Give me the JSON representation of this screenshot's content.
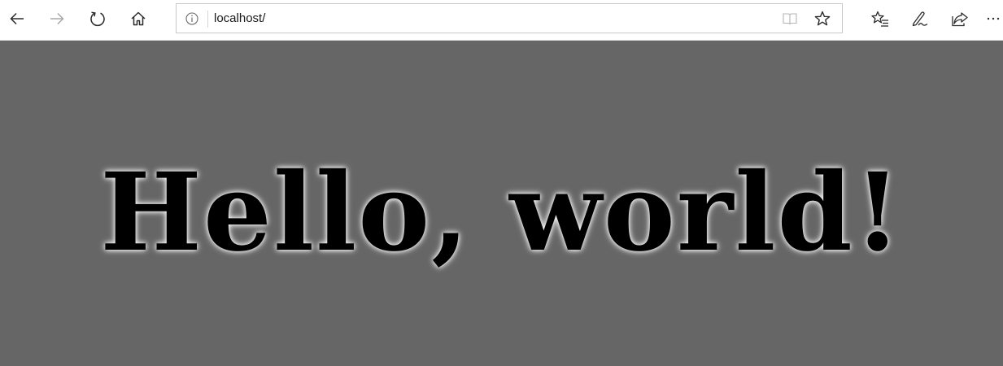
{
  "browser": {
    "nav": {
      "back_icon": "arrow-left-icon",
      "forward_icon": "arrow-right-icon",
      "refresh_icon": "refresh-icon",
      "home_icon": "home-icon"
    },
    "address_bar": {
      "url": "localhost/",
      "info_icon": "info-icon",
      "reading_view_icon": "book-icon",
      "favorite_icon": "star-icon"
    },
    "actions": {
      "favorites_icon": "favorites-list-icon",
      "notes_icon": "pen-icon",
      "share_icon": "share-icon",
      "more_icon": "more-icon"
    },
    "colors": {
      "toolbar_bg": "#ffffff",
      "icon": "#2b2b2b",
      "icon_disabled": "#a8a8a8"
    }
  },
  "page": {
    "heading": "Hello, world!",
    "colors": {
      "background": "#666666",
      "text": "#000000",
      "glow": "#ffffff"
    }
  }
}
